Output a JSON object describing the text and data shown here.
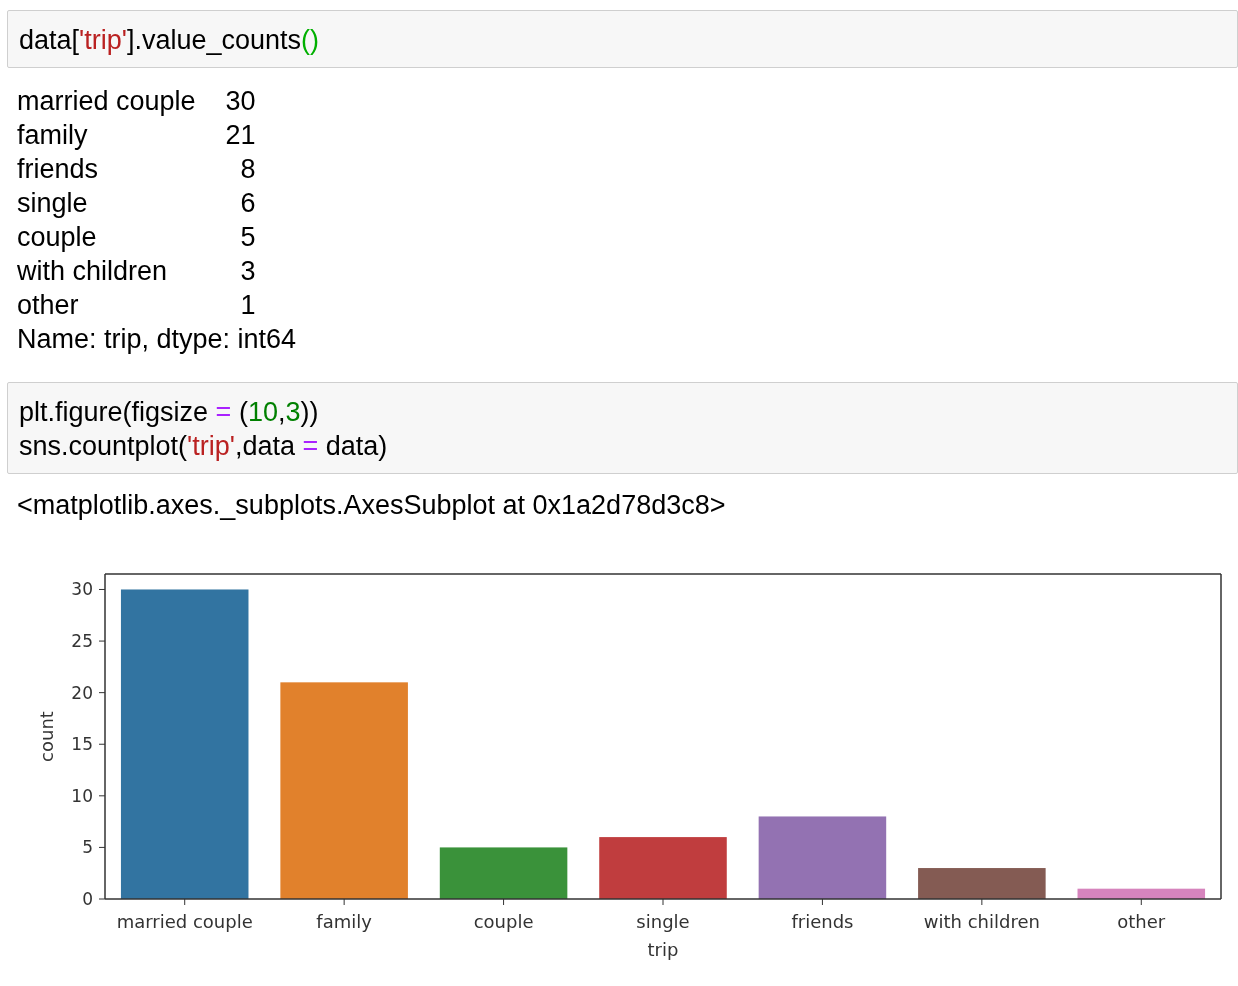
{
  "cells": [
    {
      "kind": "input",
      "lines": [
        [
          {
            "text": "data[",
            "kind": "plain"
          },
          {
            "text": "'trip'",
            "kind": "string"
          },
          {
            "text": "].value_counts",
            "kind": "plain"
          },
          {
            "text": "()",
            "kind": "matched"
          }
        ]
      ]
    },
    {
      "kind": "series",
      "rows": [
        {
          "label": "married couple",
          "value": "30"
        },
        {
          "label": "family",
          "value": "21"
        },
        {
          "label": "friends",
          "value": "8"
        },
        {
          "label": "single",
          "value": "6"
        },
        {
          "label": "couple",
          "value": "5"
        },
        {
          "label": "with children",
          "value": "3"
        },
        {
          "label": "other",
          "value": "1"
        }
      ],
      "footer": "Name: trip, dtype: int64"
    },
    {
      "kind": "input",
      "lines": [
        [
          {
            "text": "plt.figure(figsize ",
            "kind": "plain"
          },
          {
            "text": "=",
            "kind": "operator"
          },
          {
            "text": " (",
            "kind": "plain"
          },
          {
            "text": "10",
            "kind": "number"
          },
          {
            "text": ",",
            "kind": "plain"
          },
          {
            "text": "3",
            "kind": "number"
          },
          {
            "text": "))",
            "kind": "plain"
          }
        ],
        [
          {
            "text": "sns.countplot(",
            "kind": "plain"
          },
          {
            "text": "'trip'",
            "kind": "string"
          },
          {
            "text": ",data ",
            "kind": "plain"
          },
          {
            "text": "=",
            "kind": "operator"
          },
          {
            "text": " data)",
            "kind": "plain"
          }
        ]
      ]
    },
    {
      "kind": "text",
      "text": "<matplotlib.axes._subplots.AxesSubplot at 0x1a2d78d3c8>"
    },
    {
      "kind": "chart",
      "chart_data": {
        "type": "bar",
        "xlabel": "trip",
        "ylabel": "count",
        "categories": [
          "married couple",
          "family",
          "couple",
          "single",
          "friends",
          "with children",
          "other"
        ],
        "values": [
          30,
          21,
          5,
          6,
          8,
          3,
          1
        ],
        "ylim": [
          0,
          31.5
        ],
        "yticks": [
          0,
          5,
          10,
          15,
          20,
          25,
          30
        ]
      }
    }
  ]
}
